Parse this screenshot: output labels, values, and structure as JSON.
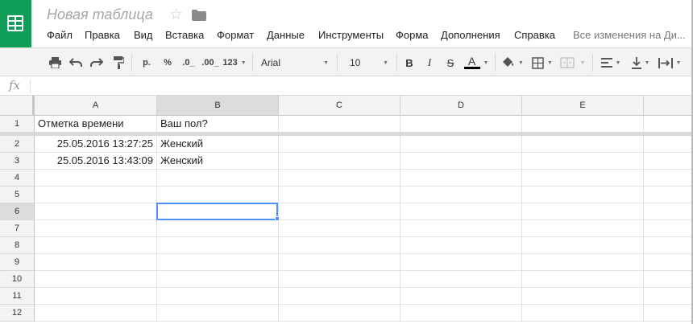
{
  "document": {
    "title": "Новая таблица",
    "save_status": "Все изменения на Ди..."
  },
  "menu": [
    "Файл",
    "Правка",
    "Вид",
    "Вставка",
    "Формат",
    "Данные",
    "Инструменты",
    "Форма",
    "Дополнения",
    "Справка"
  ],
  "toolbar": {
    "currency_label": "р.",
    "percent_label": "%",
    "decrease_decimals_label": ".0_",
    "increase_decimals_label": ".00_",
    "more_formats_label": "123",
    "font_family": "Arial",
    "font_size": "10",
    "bold_label": "B",
    "italic_label": "I",
    "strikethrough_label": "S",
    "text_color_label": "A",
    "text_color": "#000000"
  },
  "formula": {
    "fx_label": "fx",
    "content": ""
  },
  "columns": [
    "A",
    "B",
    "C",
    "D",
    "E"
  ],
  "rows": [
    "1",
    "2",
    "3",
    "4",
    "5",
    "6",
    "7",
    "8",
    "9",
    "10",
    "11",
    "12"
  ],
  "cells": {
    "r1": {
      "a": "Отметка времени",
      "b": "Ваш пол?"
    },
    "r2": {
      "a": "25.05.2016 13:27:25",
      "b": "Женский"
    },
    "r3": {
      "a": "25.05.2016 13:43:09",
      "b": "Женский"
    }
  },
  "selection": {
    "cell": "B6",
    "color": "#4d90fe"
  },
  "colors": {
    "brand": "#0f9d58",
    "header_bg": "#f3f3f3",
    "selected_header_bg": "#dcdcdc"
  }
}
